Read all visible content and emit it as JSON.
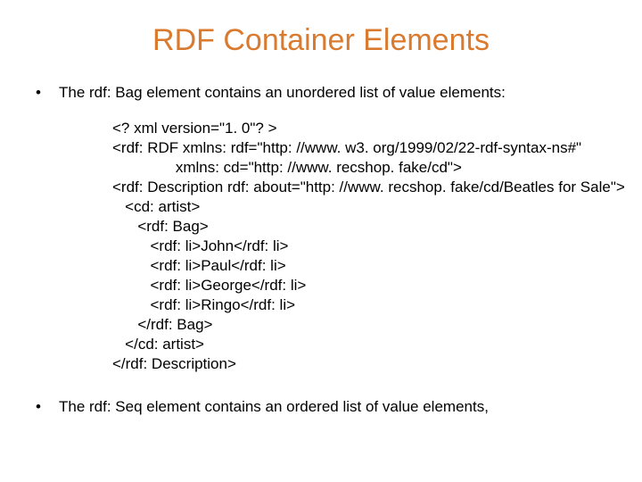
{
  "title": "RDF Container Elements",
  "bullets": {
    "b1": "The rdf: Bag element contains an unordered list of value elements:",
    "b2": "The rdf: Seq element contains an ordered list of value elements,"
  },
  "code": {
    "l1": "<? xml version=\"1. 0\"? >",
    "l2": "<rdf: RDF xmlns: rdf=\"http: //www. w3. org/1999/02/22-rdf-syntax-ns#\"",
    "l3": "               xmlns: cd=\"http: //www. recshop. fake/cd\">",
    "l4": "<rdf: Description rdf: about=\"http: //www. recshop. fake/cd/Beatles for Sale\">",
    "l5": "   <cd: artist>",
    "l6": "      <rdf: Bag>",
    "l7": "         <rdf: li>John</rdf: li>",
    "l8": "         <rdf: li>Paul</rdf: li>",
    "l9": "         <rdf: li>George</rdf: li>",
    "l10": "         <rdf: li>Ringo</rdf: li>",
    "l11": "      </rdf: Bag>",
    "l12": "   </cd: artist>",
    "l13": "</rdf: Description>"
  }
}
